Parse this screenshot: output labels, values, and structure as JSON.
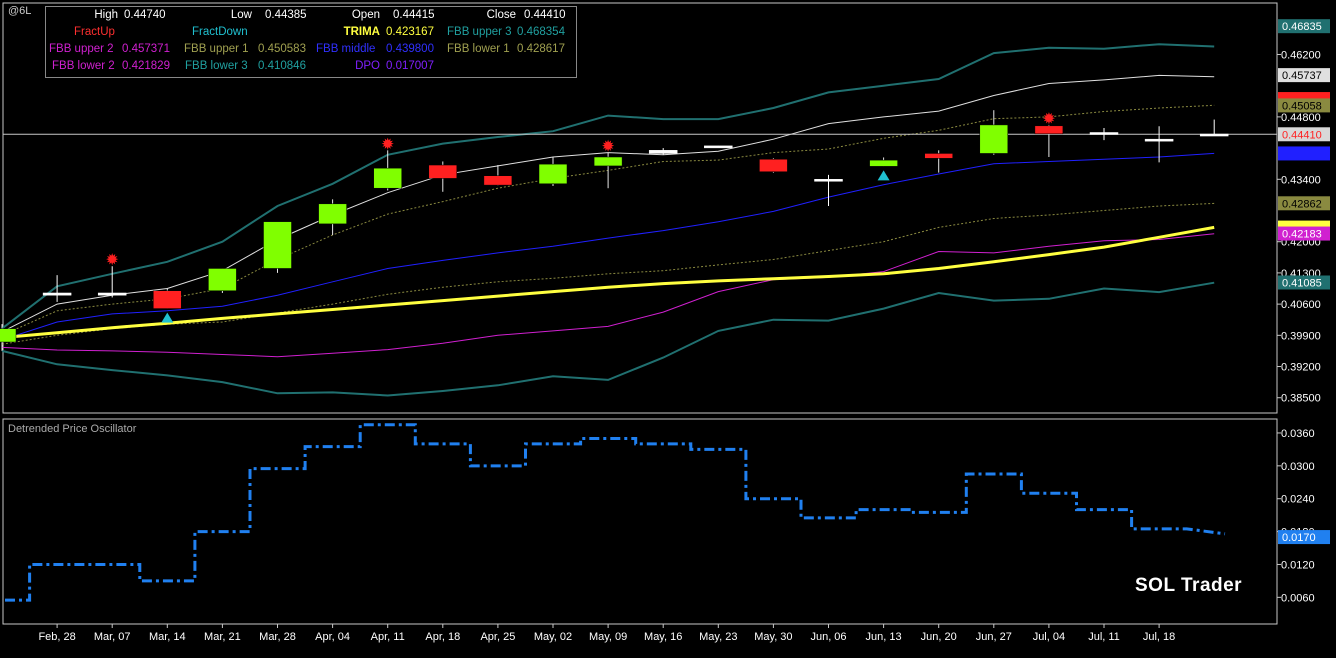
{
  "symbol": "@6L",
  "ohlc": {
    "high_label": "High",
    "high": "0.44740",
    "low_label": "Low",
    "low": "0.44385",
    "open_label": "Open",
    "open": "0.44415",
    "close_label": "Close",
    "close": "0.44410"
  },
  "legend": {
    "fractup_label": "FractUp",
    "fractdown_label": "FractDown",
    "trima_label": "TRIMA",
    "trima": "0.423167",
    "fbb_upper3_label": "FBB upper 3",
    "fbb_upper3": "0.468354",
    "fbb_upper2_label": "FBB upper 2",
    "fbb_upper2": "0.457371",
    "fbb_upper1_label": "FBB upper 1",
    "fbb_upper1": "0.450583",
    "fbb_middle_label": "FBB middle",
    "fbb_middle": "0.439800",
    "fbb_lower1_label": "FBB lower 1",
    "fbb_lower1": "0.428617",
    "fbb_lower2_label": "FBB lower 2",
    "fbb_lower2": "0.421829",
    "fbb_lower3_label": "FBB lower 3",
    "fbb_lower3": "0.410846",
    "dpo_label": "DPO",
    "dpo": "0.017007"
  },
  "colors": {
    "fractup": "#ff2020",
    "fractdown": "#20c0d0",
    "trima": "#ffff40",
    "fbb_outer": "#207070",
    "fbb_upper2": "#e0e0e0",
    "fbb_inner": "#8a8a40",
    "fbb_middle": "#2020ff",
    "fbb_lower2": "#d020d0",
    "dpo": "#2080f0",
    "candle_up": "#80ff00",
    "candle_down": "#ff2020",
    "doji": "#ffffff"
  },
  "lower_pane_title": "Detrended Price Oscillator",
  "brand": "SOL Trader",
  "chart_data": [
    {
      "type": "candlestick",
      "title": "",
      "x_tick_labels": [
        "Feb, 28",
        "Mar, 07",
        "Mar, 14",
        "Mar, 21",
        "Mar, 28",
        "Apr, 04",
        "Apr, 11",
        "Apr, 18",
        "Apr, 25",
        "May, 02",
        "May, 09",
        "May, 16",
        "May, 23",
        "May, 30",
        "Jun, 06",
        "Jun, 13",
        "Jun, 20",
        "Jun, 27",
        "Jul, 04",
        "Jul, 11",
        "Jul, 18"
      ],
      "y_tick_labels": [
        "0.46200",
        "0.44800",
        "0.43400",
        "0.42000",
        "0.41300",
        "0.40600",
        "0.39900",
        "0.39200",
        "0.38500"
      ],
      "ylim": [
        0.3818,
        0.4731
      ],
      "candles": [
        {
          "o": 0.3975,
          "h": 0.4015,
          "l": 0.3955,
          "c": 0.4005
        },
        {
          "o": 0.4085,
          "h": 0.4125,
          "l": 0.4065,
          "c": 0.408
        },
        {
          "o": 0.4085,
          "h": 0.4145,
          "l": 0.4075,
          "c": 0.408
        },
        {
          "o": 0.409,
          "h": 0.4095,
          "l": 0.405,
          "c": 0.405
        },
        {
          "o": 0.409,
          "h": 0.414,
          "l": 0.4085,
          "c": 0.414
        },
        {
          "o": 0.414,
          "h": 0.424,
          "l": 0.413,
          "c": 0.4245
        },
        {
          "o": 0.424,
          "h": 0.4295,
          "l": 0.4215,
          "c": 0.4285
        },
        {
          "o": 0.432,
          "h": 0.4405,
          "l": 0.4315,
          "c": 0.4365
        },
        {
          "o": 0.4372,
          "h": 0.438,
          "l": 0.4312,
          "c": 0.4342
        },
        {
          "o": 0.4348,
          "h": 0.4372,
          "l": 0.4326,
          "c": 0.4327
        },
        {
          "o": 0.433,
          "h": 0.439,
          "l": 0.4325,
          "c": 0.4374
        },
        {
          "o": 0.437,
          "h": 0.44,
          "l": 0.432,
          "c": 0.439
        },
        {
          "o": 0.4405,
          "h": 0.441,
          "l": 0.4395,
          "c": 0.4398
        },
        {
          "o": 0.4415,
          "h": 0.4415,
          "l": 0.4413,
          "c": 0.4414
        },
        {
          "o": 0.4385,
          "h": 0.4387,
          "l": 0.4355,
          "c": 0.4357
        },
        {
          "o": 0.434,
          "h": 0.435,
          "l": 0.428,
          "c": 0.434
        },
        {
          "o": 0.4369,
          "h": 0.4389,
          "l": 0.4369,
          "c": 0.4383
        },
        {
          "o": 0.4398,
          "h": 0.4405,
          "l": 0.4355,
          "c": 0.4387
        },
        {
          "o": 0.4398,
          "h": 0.4495,
          "l": 0.4395,
          "c": 0.4462
        },
        {
          "o": 0.446,
          "h": 0.4462,
          "l": 0.439,
          "c": 0.4442
        },
        {
          "o": 0.4445,
          "h": 0.4455,
          "l": 0.4428,
          "c": 0.4442
        },
        {
          "o": 0.443,
          "h": 0.4459,
          "l": 0.4378,
          "c": 0.443
        },
        {
          "o": 0.44415,
          "h": 0.4474,
          "l": 0.44385,
          "c": 0.4441
        }
      ],
      "series": [
        {
          "key": "fbb_upper3",
          "values": [
            0.4005,
            0.41,
            0.4128,
            0.4155,
            0.42,
            0.428,
            0.433,
            0.4395,
            0.442,
            0.4435,
            0.4448,
            0.4483,
            0.4475,
            0.4475,
            0.45,
            0.4535,
            0.455,
            0.4565,
            0.4623,
            0.4635,
            0.4633,
            0.4643,
            0.4638
          ]
        },
        {
          "key": "fbb_upper2",
          "values": [
            0.3998,
            0.406,
            0.408,
            0.4095,
            0.4135,
            0.4205,
            0.426,
            0.431,
            0.435,
            0.437,
            0.439,
            0.44,
            0.4395,
            0.4403,
            0.443,
            0.4465,
            0.448,
            0.4493,
            0.4528,
            0.4555,
            0.4563,
            0.4573,
            0.457
          ]
        },
        {
          "key": "fbb_upper1",
          "values": [
            0.399,
            0.4045,
            0.406,
            0.4072,
            0.4095,
            0.416,
            0.4215,
            0.4262,
            0.429,
            0.432,
            0.4342,
            0.436,
            0.438,
            0.4383,
            0.44,
            0.4408,
            0.4432,
            0.445,
            0.4476,
            0.448,
            0.4492,
            0.45,
            0.4506
          ]
        },
        {
          "key": "fbb_middle",
          "values": [
            0.398,
            0.402,
            0.4038,
            0.4045,
            0.4055,
            0.408,
            0.411,
            0.414,
            0.4158,
            0.4175,
            0.419,
            0.4208,
            0.4225,
            0.4245,
            0.4268,
            0.43,
            0.4328,
            0.4352,
            0.4375,
            0.438,
            0.4385,
            0.439,
            0.4398
          ]
        },
        {
          "key": "fbb_lower1",
          "values": [
            0.397,
            0.399,
            0.4005,
            0.4015,
            0.402,
            0.404,
            0.406,
            0.4082,
            0.4098,
            0.411,
            0.4118,
            0.4128,
            0.4135,
            0.4148,
            0.416,
            0.418,
            0.42,
            0.4232,
            0.4252,
            0.426,
            0.427,
            0.428,
            0.4286
          ]
        },
        {
          "key": "fbb_lower2",
          "values": [
            0.3963,
            0.3957,
            0.3955,
            0.3952,
            0.3947,
            0.3942,
            0.395,
            0.3958,
            0.3972,
            0.399,
            0.4,
            0.401,
            0.4042,
            0.4088,
            0.4115,
            0.412,
            0.4133,
            0.4178,
            0.4175,
            0.419,
            0.4202,
            0.4205,
            0.4218
          ]
        },
        {
          "key": "fbb_lower3",
          "values": [
            0.3955,
            0.3925,
            0.3912,
            0.39,
            0.3885,
            0.386,
            0.3862,
            0.3855,
            0.3865,
            0.3878,
            0.3898,
            0.389,
            0.394,
            0.4,
            0.4025,
            0.4023,
            0.405,
            0.4085,
            0.4068,
            0.4072,
            0.4095,
            0.4087,
            0.4108
          ]
        },
        {
          "key": "trima",
          "values": [
            0.3985,
            0.3996,
            0.4007,
            0.4017,
            0.4028,
            0.4038,
            0.4048,
            0.4058,
            0.4068,
            0.4078,
            0.4088,
            0.4098,
            0.4106,
            0.4112,
            0.4117,
            0.4122,
            0.4128,
            0.414,
            0.4155,
            0.4171,
            0.4188,
            0.421,
            0.4232
          ]
        }
      ],
      "fractals_up": [
        2,
        7,
        11,
        19
      ],
      "fractals_down": [
        3,
        16
      ],
      "right_badges": [
        {
          "text": "0.46835",
          "bg": "#207070",
          "fg": "#ffffff",
          "value": 0.46835
        },
        {
          "text": "0.45737",
          "bg": "#e0e0e0",
          "fg": "#000000",
          "value": 0.45737
        },
        {
          "text": "",
          "bg": "#ff2020",
          "fg": "#000000",
          "value": 0.452
        },
        {
          "text": "0.45058",
          "bg": "#8a8a40",
          "fg": "#000000",
          "value": 0.45058
        },
        {
          "text": "0.44410",
          "bg": "#d8d8d8",
          "fg": "#ff2020",
          "value": 0.4441
        },
        {
          "text": "",
          "bg": "#2020ff",
          "fg": "#ffffff",
          "value": 0.4398
        },
        {
          "text": "0.42862",
          "bg": "#8a8a40",
          "fg": "#000000",
          "value": 0.42862
        },
        {
          "text": "",
          "bg": "#ffff40",
          "fg": "#000000",
          "value": 0.42317
        },
        {
          "text": "0.42183",
          "bg": "#d020d0",
          "fg": "#ffffff",
          "value": 0.42183
        },
        {
          "text": "0.41085",
          "bg": "#207070",
          "fg": "#ffffff",
          "value": 0.41085
        }
      ]
    },
    {
      "type": "line",
      "title": "Detrended Price Oscillator",
      "y_tick_labels": [
        "0.0360",
        "0.0300",
        "0.0240",
        "0.0180",
        "0.0120",
        "0.0060"
      ],
      "ylim": [
        0.0015,
        0.038
      ],
      "steps": [
        0.0055,
        0.012,
        0.012,
        0.009,
        0.018,
        0.0295,
        0.0335,
        0.0375,
        0.034,
        0.03,
        0.034,
        0.035,
        0.034,
        0.033,
        0.024,
        0.0205,
        0.022,
        0.0215,
        0.0285,
        0.025,
        0.022,
        0.0185
      ],
      "last_value_badge": "0.0170"
    }
  ]
}
